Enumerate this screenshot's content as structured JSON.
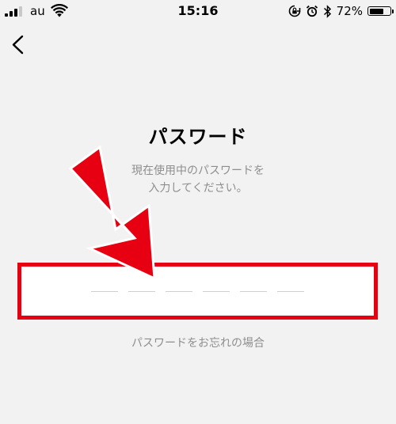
{
  "status_bar": {
    "carrier": "au",
    "time": "15:16",
    "battery_percent": "72%",
    "battery_level": 0.72,
    "signal_bars_on": 3,
    "signal_bars_total": 4
  },
  "header": {
    "back_icon": "chevron-left-icon"
  },
  "main": {
    "title": "パスワード",
    "description_line1": "現在使用中のパスワードを",
    "description_line2": "入力してください。",
    "password_slots": 6,
    "forgot_link": "パスワードをお忘れの場合"
  },
  "annotation": {
    "highlight_color": "#e60012",
    "arrow_color": "#e60012",
    "arrow_icon": "arrow-down-right-icon"
  }
}
